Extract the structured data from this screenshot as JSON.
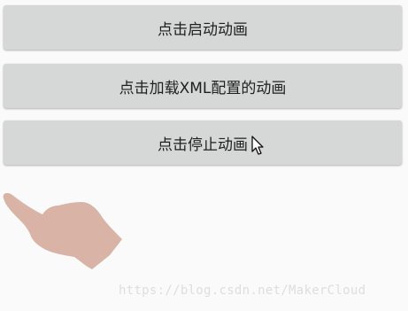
{
  "buttons": {
    "start": "点击启动动画",
    "load_xml": "点击加载XML配置的动画",
    "stop": "点击停止动画"
  },
  "watermark": "https://blog.csdn.net/MakerCloud",
  "icons": {
    "cursor": "mouse-pointer-icon",
    "hand": "pointing-hand-image"
  },
  "colors": {
    "background": "#fafafa",
    "button": "#d6d7d7",
    "button_text": "#1f1f1f",
    "hand": "#d9b4a6",
    "watermark": "#dedede"
  }
}
